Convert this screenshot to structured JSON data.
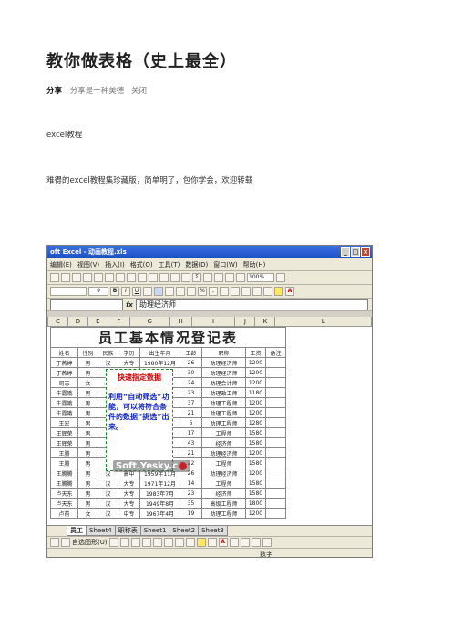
{
  "article": {
    "title": "教你做表格（史上最全）",
    "share_label": "分享",
    "share_text": "分享是一种美德",
    "close": "关闭",
    "tag": "excel教程",
    "intro": "难得的excel教程集珍藏版，简单明了，包你学会，欢迎转载"
  },
  "excel": {
    "window_title": "oft Excel - 动画教程.xls",
    "menu": [
      "编辑(E)",
      "视图(V)",
      "插入(I)",
      "格式(O)",
      "工具(T)",
      "数据(D)",
      "窗口(W)",
      "帮助(H)"
    ],
    "zoom": "100%",
    "font_size": "9",
    "formula_value": "助理经济师",
    "columns": [
      "C",
      "D",
      "E",
      "F",
      "G",
      "H",
      "I",
      "J",
      "K",
      "L"
    ],
    "sheet_title": "员工基本情况登记表",
    "headers": [
      "姓名",
      "性别",
      "民族",
      "学历",
      "出生年月",
      "工龄",
      "职称",
      "工资",
      "备注"
    ],
    "rows": [
      [
        "丁燕婷",
        "男",
        "汉",
        "大专",
        "1980年12月",
        "26",
        "助理经济师",
        "1200",
        ""
      ],
      [
        "丁燕婷",
        "男",
        "",
        "",
        "2月",
        "30",
        "助理经济师",
        "1200",
        ""
      ],
      [
        "司志",
        "女",
        "",
        "",
        "3月",
        "24",
        "助理会计师",
        "1200",
        ""
      ],
      [
        "牛露娥",
        "男",
        "",
        "",
        "1月",
        "23",
        "助理政工师",
        "1180",
        ""
      ],
      [
        "牛露娥",
        "男",
        "",
        "",
        "1月",
        "37",
        "助理工程师",
        "1200",
        ""
      ],
      [
        "牛露娥",
        "男",
        "",
        "",
        "2月",
        "21",
        "助理工程师",
        "1200",
        ""
      ],
      [
        "王宏",
        "男",
        "",
        "",
        "2月",
        "5",
        "助理工程师",
        "1280",
        ""
      ],
      [
        "王辉荣",
        "男",
        "",
        "",
        "1月",
        "17",
        "工程师",
        "1580",
        ""
      ],
      [
        "王辉荣",
        "男",
        "",
        "",
        "1月",
        "43",
        "经济师",
        "1580",
        ""
      ],
      [
        "王腾",
        "男",
        "",
        "",
        "9月",
        "21",
        "助理经济师",
        "1200",
        ""
      ],
      [
        "王腾",
        "男",
        "汉",
        "中专",
        "1983年7月",
        "22",
        "工程师",
        "1580",
        ""
      ],
      [
        "王腾腾",
        "男",
        "汉",
        "高中",
        "1959年11月",
        "26",
        "助理经济师",
        "1200",
        ""
      ],
      [
        "王腾腾",
        "男",
        "汉",
        "大专",
        "1971年12月",
        "14",
        "工程师",
        "1580",
        ""
      ],
      [
        "卢天东",
        "男",
        "汉",
        "大专",
        "1983年7月",
        "23",
        "经济师",
        "1580",
        ""
      ],
      [
        "卢天东",
        "男",
        "汉",
        "大专",
        "1949年8月",
        "35",
        "高级工程师",
        "1800",
        ""
      ],
      [
        "卢前",
        "女",
        "汉",
        "中专",
        "1967年4月",
        "19",
        "助理工程师",
        "1200",
        ""
      ]
    ],
    "callout_heading": "快速指定数据",
    "callout_body": "利用“自动筛选”功能，可以将符合条件的数据“挑选”出来。",
    "watermark": "Soft.Yesky.c",
    "tabs": [
      "员工",
      "Sheet4",
      "职称表",
      "Sheet1",
      "Sheet2",
      "Sheet3"
    ],
    "active_tab": "员工",
    "drawing_label": "自选图形(U)",
    "status": "数字"
  }
}
